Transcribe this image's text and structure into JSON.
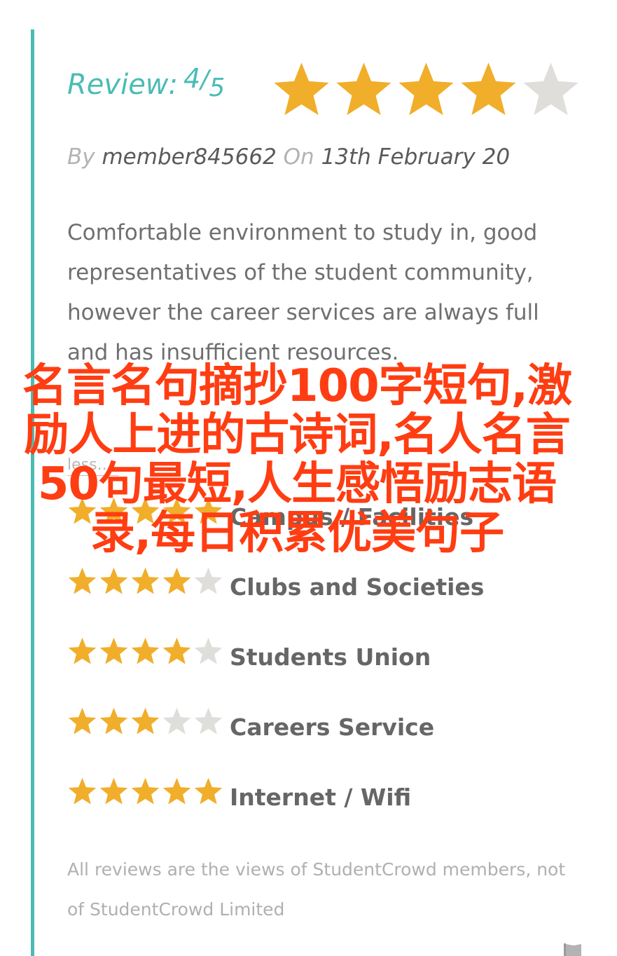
{
  "review": {
    "label": "Review:",
    "score": "4",
    "separator": "/",
    "out_of": "5",
    "rating": 4,
    "max_rating": 5
  },
  "byline": {
    "by_label": "By",
    "author": "member845662",
    "on_label": "On",
    "date": "13th February 20"
  },
  "review_text": "Comfortable environment to study in, good representatives of the student community, however the career services are always full and has insufficient resources.",
  "less_link": "less...",
  "ratings": [
    {
      "label": "Campus / Facilities",
      "stars": 5
    },
    {
      "label": "Clubs and Societies",
      "stars": 4
    },
    {
      "label": "Students Union",
      "stars": 4
    },
    {
      "label": "Careers Service",
      "stars": 3
    },
    {
      "label": "Internet / Wifi",
      "stars": 5
    }
  ],
  "disclaimer": "All reviews are the views of StudentCrowd members, not of StudentCrowd Limited",
  "overlay_text": "名言名句摘抄100字短句,激励人上进的古诗词,名人名言50句最短,人生感悟励志语录,每日积累优美句子",
  "colors": {
    "accent": "#4bbcb4",
    "star_filled": "#f0ae2a",
    "star_empty": "#e0dedb",
    "overlay": "#ff3d12"
  },
  "icons": {
    "star": "star-icon",
    "flag": "flag-icon"
  }
}
